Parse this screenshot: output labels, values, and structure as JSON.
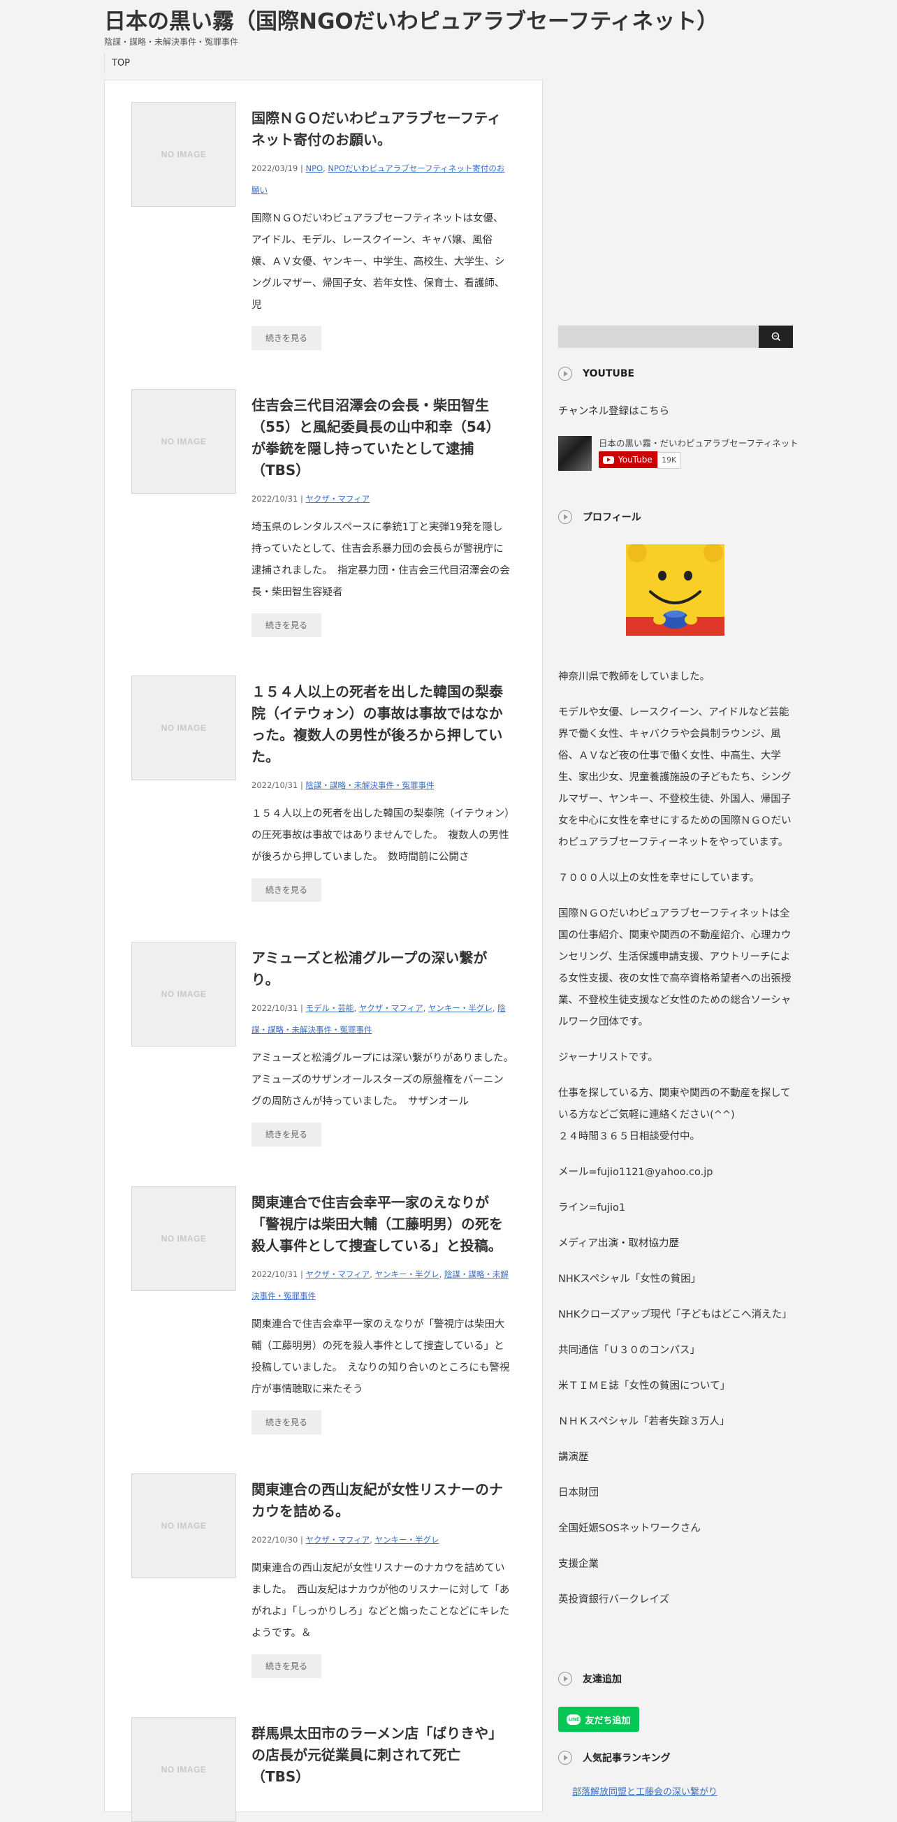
{
  "site": {
    "title": "日本の黒い霧（国際NGOだいわピュアラブセーフティネット）",
    "description": "陰謀・謀略・未解決事件・冤罪事件"
  },
  "nav": {
    "top": "TOP"
  },
  "thumb_placeholder": "NO IMAGE",
  "more_label": "続きを見る",
  "posts": [
    {
      "title": "国際ＮＧＯだいわピュアラブセーフティネット寄付のお願い。",
      "date": "2022/03/19",
      "categories": [
        "NPO",
        "NPOだいわピュアラブセーフティネット寄付のお願い"
      ],
      "excerpt": "国際ＮＧＯだいわピュアラブセーフティネットは女優、アイドル、モデル、レースクイーン、キャバ嬢、風俗嬢、ＡＶ女優、ヤンキー、中学生、高校生、大学生、シングルマザー、帰国子女、若年女性、保育士、看護師、児"
    },
    {
      "title": "住吉会三代目沼澤会の会長・柴田智生（55）と風紀委員長の山中和幸（54）が拳銃を隠し持っていたとして逮捕（TBS）",
      "date": "2022/10/31",
      "categories": [
        "ヤクザ・マフィア"
      ],
      "excerpt": "埼玉県のレンタルスペースに拳銃1丁と実弾19発を隠し持っていたとして、住吉会系暴力団の会長らが警視庁に逮捕されました。　指定暴力団・住吉会三代目沼澤会の会長・柴田智生容疑者"
    },
    {
      "title": "１５４人以上の死者を出した韓国の梨泰院（イテウォン）の事故は事故ではなかった。複数人の男性が後ろから押していた。",
      "date": "2022/10/31",
      "categories": [
        "陰謀・謀略・未解決事件・冤罪事件"
      ],
      "excerpt": "１５４人以上の死者を出した韓国の梨泰院（イテウォン）の圧死事故は事故ではありませんでした。　複数人の男性が後ろから押していました。　数時間前に公開さ"
    },
    {
      "title": "アミューズと松浦グループの深い繋がり。",
      "date": "2022/10/31",
      "categories": [
        "モデル・芸能",
        "ヤクザ・マフィア",
        "ヤンキー・半グレ",
        "陰謀・謀略・未解決事件・冤罪事件"
      ],
      "excerpt": "アミューズと松浦グループには深い繋がりがありました。　アミューズのサザンオールスターズの原盤権をバーニングの周防さんが持っていました。　サザンオール"
    },
    {
      "title": "関東連合で住吉会幸平一家のえなりが「警視庁は柴田大輔（工藤明男）の死を殺人事件として捜査している」と投稿。",
      "date": "2022/10/31",
      "categories": [
        "ヤクザ・マフィア",
        "ヤンキー・半グレ",
        "陰謀・謀略・未解決事件・冤罪事件"
      ],
      "excerpt": "関東連合で住吉会幸平一家のえなりが「警視庁は柴田大輔（工藤明男）の死を殺人事件として捜査している」と投稿していました。　えなりの知り合いのところにも警視庁が事情聴取に来たそう"
    },
    {
      "title": "関東連合の西山友紀が女性リスナーのナカウを詰める。",
      "date": "2022/10/30",
      "categories": [
        "ヤクザ・マフィア",
        "ヤンキー・半グレ"
      ],
      "excerpt": "関東連合の西山友紀が女性リスナーのナカウを詰めていました。　西山友紀はナカウが他のリスナーに対して「あがれよ」「しっかりしろ」などと煽ったことなどにキレたようです。＆"
    },
    {
      "title": "群馬県太田市のラーメン店「ばりきや」の店長が元従業員に刺されて死亡（TBS）",
      "date": "",
      "categories": [],
      "excerpt": ""
    }
  ],
  "sidebar": {
    "search_placeholder": "",
    "youtube": {
      "heading": "YOUTUBE",
      "subscribe_text": "チャンネル登録はこちら",
      "channel_name": "日本の黒い霧・だいわピュアラブセーフティネット",
      "button_label": "YouTube",
      "subscriber_count": "19K"
    },
    "profile": {
      "heading": "プロフィール",
      "paragraphs": [
        "神奈川県で教師をしていました。",
        "モデルや女優、レースクイーン、アイドルなど芸能界で働く女性、キャバクラや会員制ラウンジ、風俗、ＡＶなど夜の仕事で働く女性、中高生、大学生、家出少女、児童養護施設の子どもたち、シングルマザー、ヤンキー、不登校生徒、外国人、帰国子女を中心に女性を幸せにするための国際ＮＧＯだいわピュアラブセーフティーネットをやっています。",
        "７０００人以上の女性を幸せにしています。",
        "国際ＮＧＯだいわピュアラブセーフティネットは全国の仕事紹介、関東や関西の不動産紹介、心理カウンセリング、生活保護申請支援、アウトリーチによる女性支援、夜の女性で高卒資格希望者への出張授業、不登校生徒支援など女性のための総合ソーシャルワーク団体です。",
        "ジャーナリストです。",
        "仕事を探している方、関東や関西の不動産を探している方などご気軽に連絡ください(^^)",
        "２４時間３６５日相談受付中。",
        "メール=fujio1121@yahoo.co.jp",
        "ライン=fujio1",
        "メディア出演・取材協力歴",
        "NHKスペシャル「女性の貧困」",
        "NHKクローズアップ現代「子どもはどこへ消えた」",
        "共同通信「Ｕ３０のコンパス」",
        "米ＴＩＭＥ誌「女性の貧困について」",
        "ＮＨＫスペシャル「若者失踪３万人」",
        "講演歴",
        "日本財団",
        "全国妊娠SOSネットワークさん",
        "支援企業",
        "英投資銀行バークレイズ"
      ]
    },
    "friends": {
      "heading": "友達追加",
      "line_label": "友だち追加",
      "line_logo": "LINE"
    },
    "ranking": {
      "heading": "人気記事ランキング",
      "first_item": "部落解放同盟と工藤会の深い繋がり"
    }
  },
  "colors": {
    "link": "#3a6ec4",
    "line_green": "#06c755",
    "youtube_red": "#cc0000",
    "search_button": "#222222"
  }
}
